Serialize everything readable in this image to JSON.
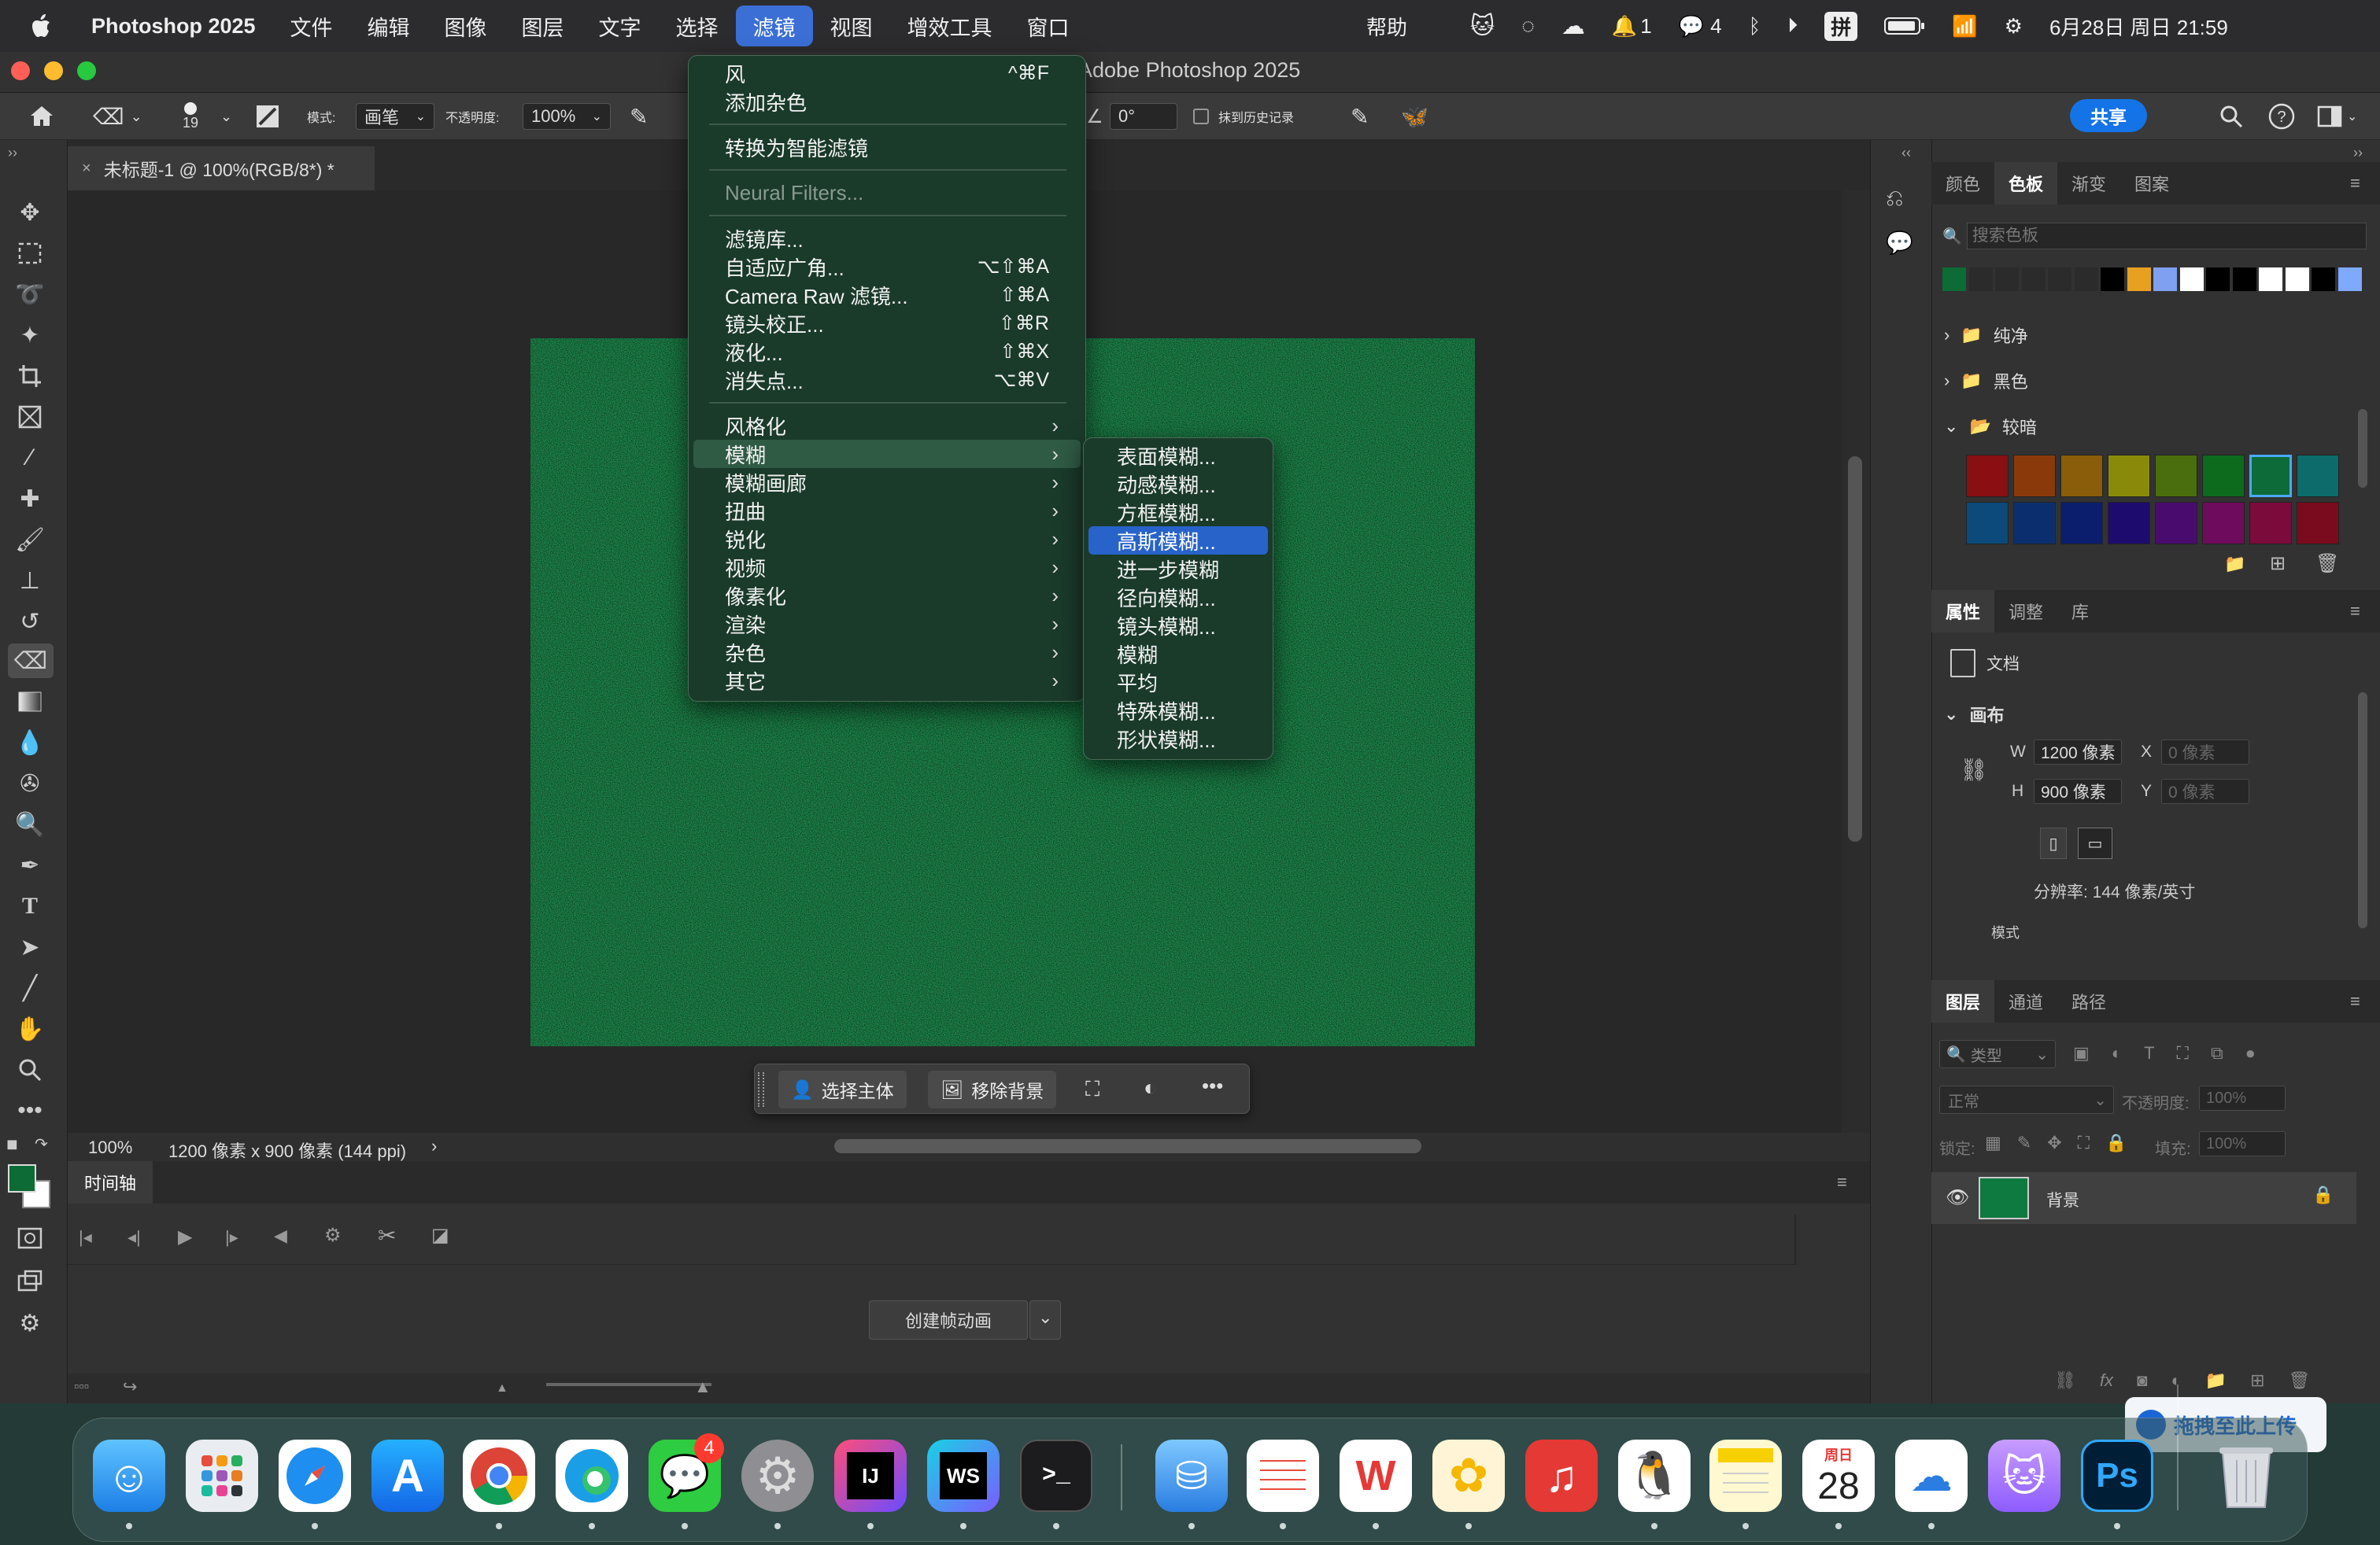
{
  "menubar": {
    "apple": "",
    "app": "Photoshop 2025",
    "items": [
      "文件",
      "编辑",
      "图像",
      "图层",
      "文字",
      "选择",
      "滤镜",
      "视图",
      "增效工具",
      "窗口",
      "帮助"
    ],
    "tray": {
      "bell_count": "1",
      "wechat_count": "4",
      "ime": "拼",
      "datetime": "6月28日 周日 21:59"
    }
  },
  "window": {
    "title": "Adobe Photoshop 2025"
  },
  "options": {
    "brush_size": "19",
    "mode_label": "模式:",
    "mode_value": "画笔",
    "opacity_label": "不透明度:",
    "opacity_value": "100%",
    "angle_value": "0°",
    "erase_history": "抹到历史记录",
    "share": "共享"
  },
  "document": {
    "tab": "未标题-1 @ 100%(RGB/8*) *",
    "zoom": "100%",
    "info": "1200 像素 x 900 像素 (144 ppi)",
    "canvas_color": "#1d8a4c"
  },
  "context_bar": {
    "select_subject": "选择主体",
    "remove_bg": "移除背景"
  },
  "filter_menu": {
    "items": [
      {
        "label": "风",
        "shortcut": "^⌘F"
      },
      {
        "label": "添加杂色",
        "shortcut": ""
      },
      {
        "label": "转换为智能滤镜",
        "shortcut": ""
      },
      {
        "label": "Neural Filters...",
        "shortcut": "",
        "disabled": true
      },
      {
        "label": "滤镜库...",
        "shortcut": ""
      },
      {
        "label": "自适应广角...",
        "shortcut": "⌥⇧⌘A"
      },
      {
        "label": "Camera Raw 滤镜...",
        "shortcut": "⇧⌘A"
      },
      {
        "label": "镜头校正...",
        "shortcut": "⇧⌘R"
      },
      {
        "label": "液化...",
        "shortcut": "⇧⌘X"
      },
      {
        "label": "消失点...",
        "shortcut": "⌥⌘V"
      },
      {
        "label": "风格化",
        "submenu": true
      },
      {
        "label": "模糊",
        "submenu": true,
        "highlight": true
      },
      {
        "label": "模糊画廊",
        "submenu": true
      },
      {
        "label": "扭曲",
        "submenu": true
      },
      {
        "label": "锐化",
        "submenu": true
      },
      {
        "label": "视频",
        "submenu": true
      },
      {
        "label": "像素化",
        "submenu": true
      },
      {
        "label": "渲染",
        "submenu": true
      },
      {
        "label": "杂色",
        "submenu": true
      },
      {
        "label": "其它",
        "submenu": true
      }
    ]
  },
  "blur_menu": {
    "items": [
      "表面模糊...",
      "动感模糊...",
      "方框模糊...",
      "高斯模糊...",
      "进一步模糊",
      "径向模糊...",
      "镜头模糊...",
      "模糊",
      "平均",
      "特殊模糊...",
      "形状模糊..."
    ],
    "selected_index": 3
  },
  "timeline": {
    "title": "时间轴",
    "create_button": "创建帧动画"
  },
  "swatches_panel": {
    "tabs": [
      "颜色",
      "色板",
      "渐变",
      "图案"
    ],
    "active": 1,
    "search_placeholder": "搜索色板",
    "recent": [
      "#0d6b35",
      "#2b2b2b",
      "#2b2b2b",
      "#2b2b2b",
      "#2b2b2b",
      "#2b2b2b",
      "#000000",
      "#e8a020",
      "#7fa0f0",
      "#ffffff",
      "#000000",
      "#000000",
      "#ffffff",
      "#ffffff",
      "#000000",
      "#7fa8ff"
    ],
    "folders": [
      "纯净",
      "黑色",
      "较暗"
    ],
    "dark_swatches": [
      "#8a0f12",
      "#8a3a0a",
      "#8a5d0a",
      "#8a8a0a",
      "#4a6e0d",
      "#0d6b1e",
      "#0d6b3a",
      "#0d6b6b",
      "#0b4a7a",
      "#0b2f6e",
      "#0b1e6e",
      "#1e0b6e",
      "#4a0b6e",
      "#6e0b5d",
      "#7a0b3a",
      "#7a0b1e"
    ]
  },
  "properties_panel": {
    "tabs": [
      "属性",
      "调整",
      "库"
    ],
    "doc_label": "文档",
    "canvas_section": "画布",
    "w_label": "W",
    "w_value": "1200 像素",
    "h_label": "H",
    "h_value": "900 像素",
    "x_label": "X",
    "x_value": "0 像素",
    "y_label": "Y",
    "y_value": "0 像素",
    "resolution": "分辨率: 144 像素/英寸",
    "mode_label": "模式"
  },
  "layers_panel": {
    "tabs": [
      "图层",
      "通道",
      "路径"
    ],
    "filter_kind": "类型",
    "blend_mode": "正常",
    "opacity_label": "不透明度:",
    "opacity_value": "100%",
    "lock_label": "锁定:",
    "fill_label": "填充:",
    "fill_value": "100%",
    "layer_name": "背景"
  },
  "dock": {
    "wechat_badge": "4",
    "calendar_weekday": "周日",
    "calendar_day": "28",
    "toast": "拖拽至此上传"
  }
}
